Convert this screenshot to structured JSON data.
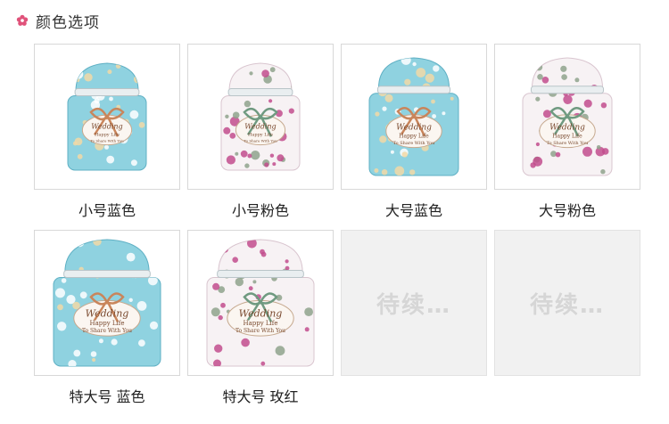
{
  "header": {
    "title": "颜色选项",
    "icon": "flower-icon",
    "accent": "#e0527a"
  },
  "options": [
    {
      "label": "小号蓝色",
      "image": "blue-floral-tin-small",
      "theme": "blue",
      "size": "small"
    },
    {
      "label": "小号粉色",
      "image": "pink-floral-tin-small",
      "theme": "pink",
      "size": "small"
    },
    {
      "label": "大号蓝色",
      "image": "blue-floral-tin-large",
      "theme": "blue",
      "size": "large"
    },
    {
      "label": "大号粉色",
      "image": "pink-floral-tin-large",
      "theme": "pink",
      "size": "large"
    },
    {
      "label": "特大号 蓝色",
      "image": "blue-floral-tin-xlarge",
      "theme": "blue",
      "size": "xlarge"
    },
    {
      "label": "特大号 玫红",
      "image": "rose-floral-tin-xlarge",
      "theme": "pink",
      "size": "xlarge"
    },
    {
      "placeholder": "待续…"
    },
    {
      "placeholder": "待续…"
    }
  ],
  "tin_text": {
    "line1": "Wedding",
    "line2": "Happy Life",
    "line3": "To Share With You"
  },
  "colors": {
    "blue_body": "#8fd2e0",
    "pink_body": "#f7f2f4",
    "pink_accent": "#c24d8d",
    "ribbon_brown": "#c9855b",
    "ribbon_green": "#6f9a80"
  }
}
